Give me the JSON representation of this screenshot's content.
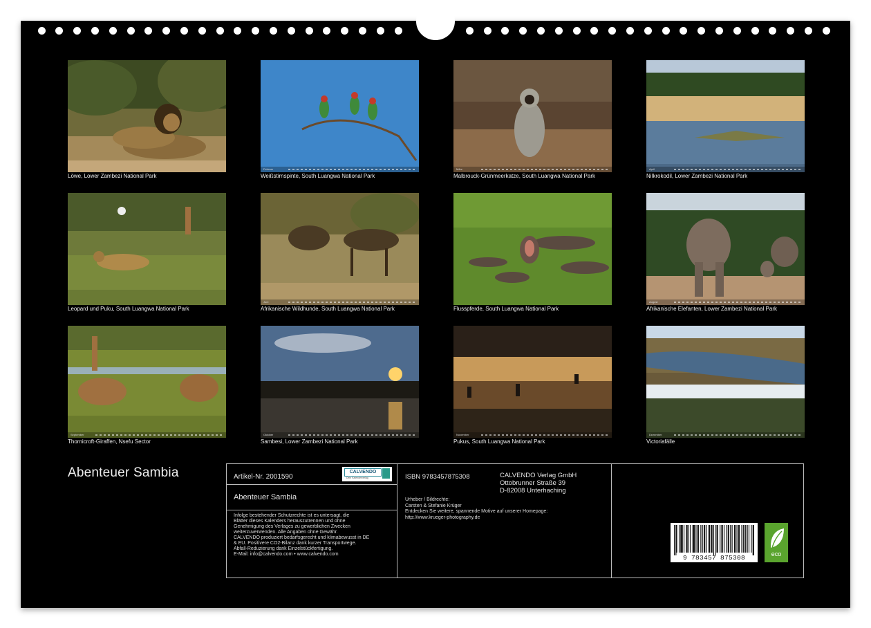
{
  "calendar": {
    "title": "Abenteuer Sambia"
  },
  "photos": [
    {
      "caption": "Löwe, Lower Zambezi National Park",
      "icon": "lion-photo"
    },
    {
      "caption": "Weißstirnspinte, South Luangwa National Park",
      "icon": "bee-eaters-photo",
      "month": "Februar"
    },
    {
      "caption": "Malbrouck-Grünmeerkatze, South Luangwa National Park",
      "icon": "monkey-photo",
      "month": "März"
    },
    {
      "caption": "Nilkrokodil, Lower Zambezi National Park",
      "icon": "crocodile-photo",
      "month": "April"
    },
    {
      "caption": "Leopard und Puku, South Luangwa National Park",
      "icon": "leopard-photo"
    },
    {
      "caption": "Afrikanische Wildhunde, South Luangwa National Park",
      "icon": "wild-dogs-photo",
      "month": "Juni"
    },
    {
      "caption": "Flusspferde, South Luangwa National Park",
      "icon": "hippos-photo"
    },
    {
      "caption": "Afrikanische Elefanten, Lower Zambezi National Park",
      "icon": "elephants-photo",
      "month": "August"
    },
    {
      "caption": "Thornicroft-Giraffen, Nsefu Sector",
      "icon": "giraffes-photo",
      "month": "September"
    },
    {
      "caption": "Sambesi, Lower Zambezi National Park",
      "icon": "sunset-photo",
      "month": "Oktober"
    },
    {
      "caption": "Pukus, South Luangwa National Park",
      "icon": "pukus-photo",
      "month": "November"
    },
    {
      "caption": "Victoriafälle",
      "icon": "waterfall-photo",
      "month": "Dezember"
    }
  ],
  "info": {
    "article": "Artikel-Nr. 2001590",
    "logo_text": "CALVENDO",
    "logo_sub": "Dein Kalenderverlag",
    "title": "Abenteuer Sambia",
    "legal": [
      "Infolge bestehender Schutzrechte ist es untersagt, die",
      "Blätter dieses Kalenders herauszutrennen und ohne",
      "Genehmigung des Verlages zu gewerblichen Zwecken",
      "weiterzuverwenden. Alle Angaben ohne Gewähr.",
      "CALVENDO produziert bedarfsgerecht und klimabewusst in DE",
      "& EU. Positivere CO2-Bilanz dank kurzer Transportwege.",
      "Abfall-Reduzierung dank Einzelstückfertigung.",
      "E-Mail: info@calvendo.com • www.calvendo.com"
    ],
    "isbn": "ISBN 9783457875308",
    "publisher": [
      "CALVENDO Verlag GmbH",
      "Ottobrunner Straße 39",
      "D-82008 Unterhaching"
    ],
    "credits": [
      "Urheber / Bildrechte:",
      "Carsten & Stefanie Krüger",
      "Entdecken Sie weitere, spannende Motive auf unserer Homepage:",
      "http://www.krueger-photography.de"
    ],
    "barcode_number": "9  783457  875308",
    "eco_label": "eco"
  }
}
